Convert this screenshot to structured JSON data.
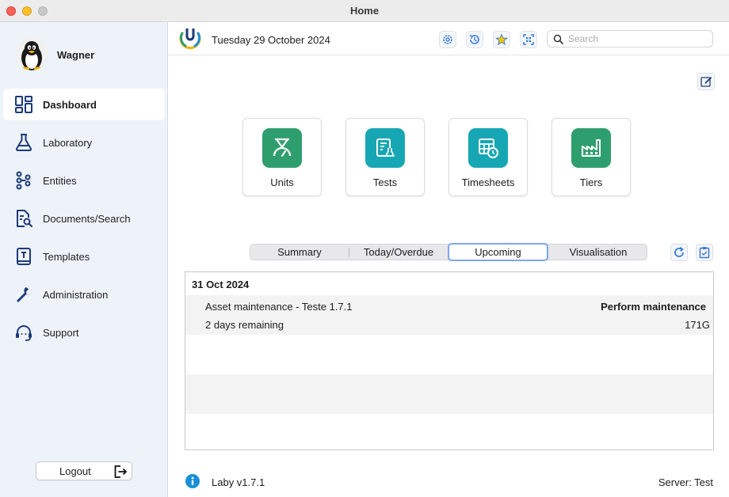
{
  "window": {
    "title": "Home"
  },
  "user": {
    "name": "Wagner"
  },
  "sidebar": {
    "items": [
      {
        "label": "Dashboard",
        "icon": "dashboard-icon",
        "active": true
      },
      {
        "label": "Laboratory",
        "icon": "flask-icon",
        "active": false
      },
      {
        "label": "Entities",
        "icon": "entities-icon",
        "active": false
      },
      {
        "label": "Documents/Search",
        "icon": "document-search-icon",
        "active": false
      },
      {
        "label": "Templates",
        "icon": "template-icon",
        "active": false
      },
      {
        "label": "Administration",
        "icon": "wrench-icon",
        "active": false
      },
      {
        "label": "Support",
        "icon": "headset-icon",
        "active": false
      }
    ],
    "logout_label": "Logout"
  },
  "header": {
    "date": "Tuesday 29 October 2024",
    "tools": [
      "settings-icon",
      "history-icon",
      "favorites-star-icon",
      "qr-scan-icon"
    ],
    "search_placeholder": "Search",
    "search_value": ""
  },
  "tiles": [
    {
      "label": "Units",
      "icon": "units-icon",
      "color": "#2f9e6e"
    },
    {
      "label": "Tests",
      "icon": "tests-icon",
      "color": "#17a7b4"
    },
    {
      "label": "Timesheets",
      "icon": "timesheets-icon",
      "color": "#17a7b4"
    },
    {
      "label": "Tiers",
      "icon": "tiers-factory-icon",
      "color": "#2f9e6e"
    }
  ],
  "tabs": [
    {
      "label": "Summary",
      "active": false
    },
    {
      "label": "Today/Overdue",
      "active": false
    },
    {
      "label": "Upcoming",
      "active": true
    },
    {
      "label": "Visualisation",
      "active": false
    }
  ],
  "upcoming": {
    "date": "31 Oct 2024",
    "items": [
      {
        "title": "Asset maintenance - Teste 1.7.1",
        "action": "Perform maintenance",
        "remaining": "2 days remaining",
        "code": "171G"
      }
    ]
  },
  "footer": {
    "version": "Laby v1.7.1",
    "server": "Server: Test"
  },
  "colors": {
    "accent": "#1d3a78",
    "active_tab_border": "#7ea6ef",
    "info": "#1a8fd6"
  }
}
